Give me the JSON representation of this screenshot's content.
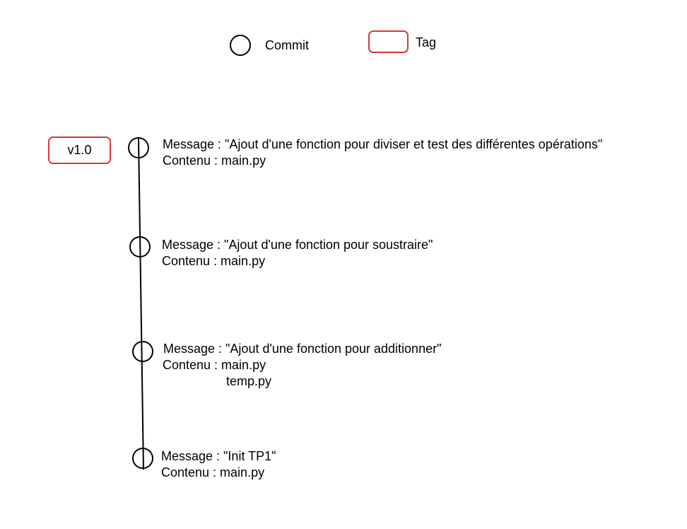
{
  "legend": {
    "commit_label": "Commit",
    "tag_label": "Tag",
    "commit_symbol": "circle",
    "tag_symbol": "rounded-rectangle"
  },
  "colors": {
    "tag_border": "#d9383a",
    "line": "#000000",
    "text": "#000000",
    "background": "#ffffff"
  },
  "commits": [
    {
      "message_line": "Message : \"Ajout d'une fonction pour diviser et test des différentes opérations\"",
      "content_lines": [
        "Contenu : main.py"
      ],
      "tag": "v1.0"
    },
    {
      "message_line": "Message : \"Ajout d'une fonction pour soustraire\"",
      "content_lines": [
        "Contenu : main.py"
      ],
      "tag": ""
    },
    {
      "message_line": "Message : \"Ajout d'une fonction pour additionner\"",
      "content_lines": [
        "Contenu : main.py",
        "temp.py"
      ],
      "tag": ""
    },
    {
      "message_line": "Message : \"Init TP1\"",
      "content_lines": [
        "Contenu : main.py"
      ],
      "tag": ""
    }
  ]
}
